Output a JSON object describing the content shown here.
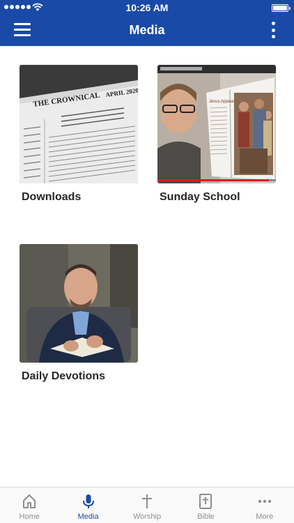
{
  "status_bar": {
    "time": "10:26 AM"
  },
  "nav": {
    "title": "Media"
  },
  "cards": [
    {
      "label": "Downloads"
    },
    {
      "label": "Sunday School"
    },
    {
      "label": "Daily Devotions"
    }
  ],
  "thumb_text": {
    "downloads_masthead": "THE CROWNICAL",
    "downloads_date": "APRIL 2020",
    "sunday_caption": "Jesus Appears to Thomas"
  },
  "tabs": [
    {
      "label": "Home",
      "icon": "home-icon",
      "active": false
    },
    {
      "label": "Media",
      "icon": "microphone-icon",
      "active": true
    },
    {
      "label": "Worship",
      "icon": "cross-icon",
      "active": false
    },
    {
      "label": "Bible",
      "icon": "bible-icon",
      "active": false
    },
    {
      "label": "More",
      "icon": "more-dots-icon",
      "active": false
    }
  ],
  "colors": {
    "brand": "#1a4aa8",
    "tab_inactive": "#8e8e93",
    "label_text": "#262626"
  }
}
